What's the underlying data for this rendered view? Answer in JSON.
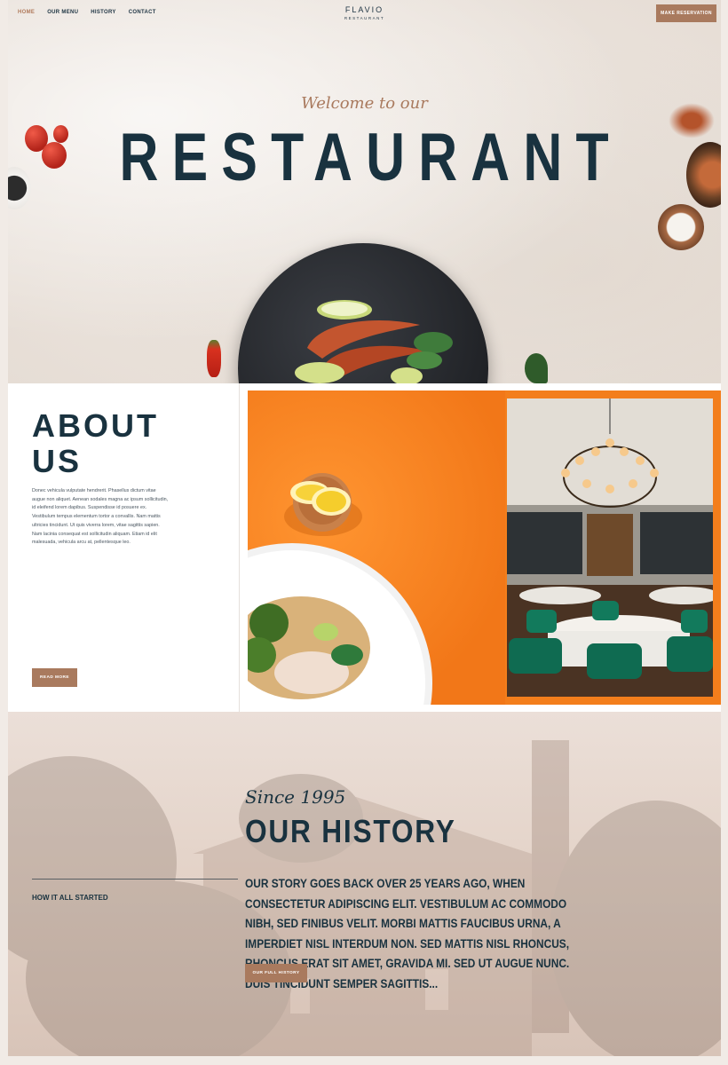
{
  "header": {
    "nav": [
      "HOME",
      "OUR MENU",
      "HISTORY",
      "CONTACT"
    ],
    "active_nav": "HOME",
    "logo_name": "FLAVIO",
    "logo_sub": "RESTAURANT",
    "reserve_label": "MAKE RESERVATION"
  },
  "hero": {
    "welcome": "Welcome to our",
    "title": "RESTAURANT"
  },
  "about": {
    "title": "ABOUT US",
    "text": "Donec vehicula vulputate hendrerit. Phasellus dictum vitae augue non aliquet. Aenean sodales magna ac ipsum sollicitudin, id eleifend lorem dapibus. Suspendisse id posuere ex. Vestibulum tempus elementum tortor a convallis. Nam mattis ultricies tincidunt. Ut quis viverra lorem, vitae sagittis sapien. Nam lacinia consequat est sollicitudin aliquam. Etiam id elit malesuada, vehicula arcu at, pellentesque leo.",
    "button_label": "READ MORE"
  },
  "history": {
    "since": "Since 1995",
    "title": "OUR HISTORY",
    "label": "HOW IT ALL STARTED",
    "text": "Our story goes back over 25 years ago, when consectetur adipiscing elit. Vestibulum ac commodo nibh, sed finibus velit. Morbi mattis faucibus urna, a imperdiet nisl interdum non. Sed mattis nisl rhoncus, rhoncus erat sit amet, gravida mi. Sed ut augue nunc. Duis tincidunt semper sagittis...",
    "button_label": "OUR FULL HISTORY"
  },
  "colors": {
    "accent": "#a97a5e",
    "navy": "#19323f",
    "orange": "#f37e1c"
  }
}
